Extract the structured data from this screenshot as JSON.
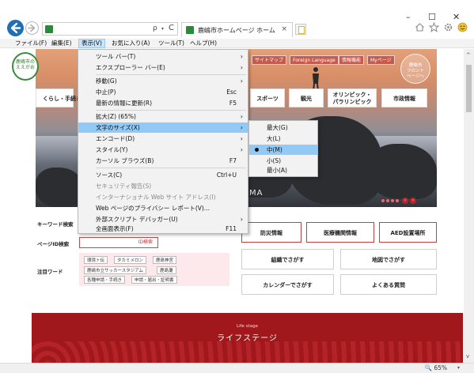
{
  "window": {
    "minimize": "–",
    "maximize": "☐",
    "close": "✕"
  },
  "address_bar": {
    "search_icon": "ρ",
    "dropdown": "▾",
    "refresh": "C"
  },
  "tab": {
    "title": "鹿嶋市ホームページ ホーム",
    "close": "×"
  },
  "toolbar_icons": [
    "home-icon",
    "favorites-star-icon",
    "settings-gear-icon",
    "smiley-feedback-icon"
  ],
  "menubar": {
    "file": "ファイル(F)",
    "edit": "編集(E)",
    "view": "表示(V)",
    "favorites": "お気に入り(A)",
    "tools": "ツール(T)",
    "help": "ヘルプ(H)"
  },
  "view_menu": {
    "items": [
      {
        "label": "ツール バー(T)",
        "shortcut": "",
        "arrow": "›"
      },
      {
        "label": "エクスプローラー バー(E)",
        "shortcut": "",
        "arrow": "›"
      },
      {
        "label": "移動(G)",
        "shortcut": "",
        "arrow": "›"
      },
      {
        "label": "中止(P)",
        "shortcut": "Esc",
        "arrow": ""
      },
      {
        "label": "最新の情報に更新(R)",
        "shortcut": "F5",
        "arrow": ""
      },
      {
        "label": "拡大(Z) (65%)",
        "shortcut": "",
        "arrow": "›"
      },
      {
        "label": "文字のサイズ(X)",
        "shortcut": "",
        "arrow": "›"
      },
      {
        "label": "エンコード(D)",
        "shortcut": "",
        "arrow": "›"
      },
      {
        "label": "スタイル(Y)",
        "shortcut": "",
        "arrow": "›"
      },
      {
        "label": "カーソル ブラウズ(B)",
        "shortcut": "F7",
        "arrow": ""
      },
      {
        "label": "ソース(C)",
        "shortcut": "Ctrl+U",
        "arrow": ""
      },
      {
        "label": "セキュリティ報告(S)",
        "shortcut": "",
        "arrow": ""
      },
      {
        "label": "インターナショナル Web サイト アドレス(I)",
        "shortcut": "",
        "arrow": ""
      },
      {
        "label": "Web ページのプライバシー レポート(V)...",
        "shortcut": "",
        "arrow": ""
      },
      {
        "label": "外部スクリプト デバッガー(U)",
        "shortcut": "",
        "arrow": "›"
      },
      {
        "label": "全画面表示(F)",
        "shortcut": "F11",
        "arrow": ""
      }
    ]
  },
  "text_size_menu": {
    "items": [
      "最大(G)",
      "大(L)",
      "中(M)",
      "小(S)",
      "最小(A)"
    ],
    "selected": "中(M)"
  },
  "site": {
    "logo_line1": "鹿嶋市の",
    "logo_line2": "ええがお",
    "top_links": [
      "サイトマップ",
      "Foreign Language",
      "情報機能",
      "Myページ"
    ],
    "front_badge_line1": "鹿嶋市",
    "front_badge_line2": "フロント",
    "front_badge_line3": "ページへ",
    "nav": {
      "kurashi": "くらし・手続き",
      "sports": "スポーツ",
      "kanko": "観光",
      "olympic_line1": "オリンピック・",
      "olympic_line2": "パラリンピック",
      "shisei": "市政情報"
    },
    "hero_caption": "MA",
    "hero_arrows": [
      "‹",
      "›"
    ],
    "search": {
      "keyword_label": "キーワード検索",
      "page_id_label": "ページID検索",
      "id_button": "ID検索",
      "attention_label": "注目ワード",
      "keywords": [
        "環境ト伝",
        "タカミメロン",
        "鹿島神宮",
        "鹿嶋市立サッカースタジアム",
        "鹿島灘",
        "各種申請・手続き",
        "申請・届出・証明書"
      ]
    },
    "buttons": {
      "bousai": "防災情報",
      "iryou": "医療機関情報",
      "aed": "AED設置場所",
      "soshiki": "組織でさがす",
      "chizu": "地図でさがす",
      "calendar": "カレンダーでさがす",
      "faq": "よくある質問"
    },
    "life_stage_small": "Life stage",
    "life_stage_title": "ライフステージ"
  },
  "status": {
    "zoom": "🔍 65%",
    "zoom_dropdown": "▾"
  },
  "scrollbar": {
    "up": "^",
    "down": "v"
  },
  "colors": {
    "accent_red": "#a0181c",
    "menu_highlight": "#91c9f7",
    "active_menu": "#cce4f7",
    "brand_green": "#2a8a3a",
    "back_button_blue": "#1f6fb5"
  }
}
